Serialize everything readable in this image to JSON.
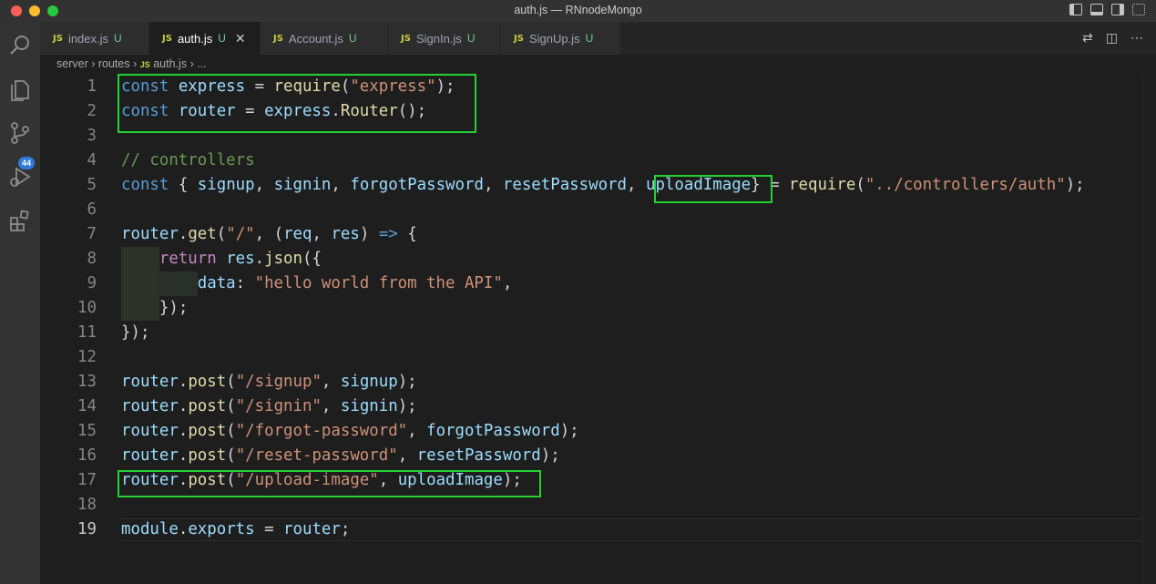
{
  "window": {
    "title": "auth.js — RNnodeMongo",
    "traffic_lights": {
      "close": "#ff5f57",
      "minimize": "#febc2e",
      "zoom": "#28c840"
    }
  },
  "activity_bar": {
    "items": [
      {
        "name": "explorer-icon"
      },
      {
        "name": "files-icon"
      },
      {
        "name": "source-control-icon",
        "badge": "44"
      },
      {
        "name": "run-debug-icon"
      },
      {
        "name": "extensions-icon"
      }
    ]
  },
  "tabs": [
    {
      "file_type": "JS",
      "label": "index.js",
      "status": "U"
    },
    {
      "file_type": "JS",
      "label": "auth.js",
      "status": "U",
      "active": true
    },
    {
      "file_type": "JS",
      "label": "Account.js",
      "status": "U"
    },
    {
      "file_type": "JS",
      "label": "SignIn.js",
      "status": "U"
    },
    {
      "file_type": "JS",
      "label": "SignUp.js",
      "status": "U"
    }
  ],
  "breadcrumb": {
    "items": [
      "server",
      "routes"
    ],
    "file_type": "JS",
    "file": "auth.js",
    "more": "..."
  },
  "editor": {
    "current_line": "19",
    "highlight_color": "#22d233",
    "lines": [
      {
        "n": "1",
        "tokens": [
          [
            "kw",
            "const "
          ],
          [
            "var",
            "express"
          ],
          [
            "pu",
            " = "
          ],
          [
            "fn",
            "require"
          ],
          [
            "pu",
            "("
          ],
          [
            "str",
            "\"express\""
          ],
          [
            "pu",
            ");"
          ]
        ]
      },
      {
        "n": "2",
        "tokens": [
          [
            "kw",
            "const "
          ],
          [
            "var",
            "router"
          ],
          [
            "pu",
            " = "
          ],
          [
            "var",
            "express"
          ],
          [
            "pu",
            "."
          ],
          [
            "fn",
            "Router"
          ],
          [
            "pu",
            "();"
          ]
        ]
      },
      {
        "n": "3",
        "tokens": []
      },
      {
        "n": "4",
        "tokens": [
          [
            "cm",
            "// controllers"
          ]
        ]
      },
      {
        "n": "5",
        "tokens": [
          [
            "kw",
            "const "
          ],
          [
            "pu",
            "{ "
          ],
          [
            "var",
            "signup"
          ],
          [
            "pu",
            ", "
          ],
          [
            "var",
            "signin"
          ],
          [
            "pu",
            ", "
          ],
          [
            "var",
            "forgotPassword"
          ],
          [
            "pu",
            ", "
          ],
          [
            "var",
            "resetPassword"
          ],
          [
            "pu",
            ", "
          ],
          [
            "var",
            "uploadImage"
          ],
          [
            "pu",
            "} = "
          ],
          [
            "fn",
            "require"
          ],
          [
            "pu",
            "("
          ],
          [
            "str",
            "\"../controllers/auth\""
          ],
          [
            "pu",
            ");"
          ]
        ]
      },
      {
        "n": "6",
        "tokens": []
      },
      {
        "n": "7",
        "tokens": [
          [
            "var",
            "router"
          ],
          [
            "pu",
            "."
          ],
          [
            "fn",
            "get"
          ],
          [
            "pu",
            "("
          ],
          [
            "str",
            "\"/\""
          ],
          [
            "pu",
            ", ("
          ],
          [
            "var",
            "req"
          ],
          [
            "pu",
            ", "
          ],
          [
            "var",
            "res"
          ],
          [
            "pu",
            ") "
          ],
          [
            "kw",
            "=>"
          ],
          [
            "pu",
            " {"
          ]
        ]
      },
      {
        "n": "8",
        "tokens": [
          [
            "pu",
            "    "
          ],
          [
            "ctl",
            "return "
          ],
          [
            "var",
            "res"
          ],
          [
            "pu",
            "."
          ],
          [
            "fn",
            "json"
          ],
          [
            "pu",
            "({"
          ]
        ]
      },
      {
        "n": "9",
        "tokens": [
          [
            "pu",
            "        "
          ],
          [
            "var",
            "data"
          ],
          [
            "pu",
            ": "
          ],
          [
            "str",
            "\"hello world from the API\""
          ],
          [
            "pu",
            ","
          ]
        ]
      },
      {
        "n": "10",
        "tokens": [
          [
            "pu",
            "    "
          ],
          [
            "pu",
            "});"
          ]
        ]
      },
      {
        "n": "11",
        "tokens": [
          [
            "pu",
            "});"
          ]
        ]
      },
      {
        "n": "12",
        "tokens": []
      },
      {
        "n": "13",
        "tokens": [
          [
            "var",
            "router"
          ],
          [
            "pu",
            "."
          ],
          [
            "fn",
            "post"
          ],
          [
            "pu",
            "("
          ],
          [
            "str",
            "\"/signup\""
          ],
          [
            "pu",
            ", "
          ],
          [
            "var",
            "signup"
          ],
          [
            "pu",
            ");"
          ]
        ]
      },
      {
        "n": "14",
        "tokens": [
          [
            "var",
            "router"
          ],
          [
            "pu",
            "."
          ],
          [
            "fn",
            "post"
          ],
          [
            "pu",
            "("
          ],
          [
            "str",
            "\"/signin\""
          ],
          [
            "pu",
            ", "
          ],
          [
            "var",
            "signin"
          ],
          [
            "pu",
            ");"
          ]
        ]
      },
      {
        "n": "15",
        "tokens": [
          [
            "var",
            "router"
          ],
          [
            "pu",
            "."
          ],
          [
            "fn",
            "post"
          ],
          [
            "pu",
            "("
          ],
          [
            "str",
            "\"/forgot-password\""
          ],
          [
            "pu",
            ", "
          ],
          [
            "var",
            "forgotPassword"
          ],
          [
            "pu",
            ");"
          ]
        ]
      },
      {
        "n": "16",
        "tokens": [
          [
            "var",
            "router"
          ],
          [
            "pu",
            "."
          ],
          [
            "fn",
            "post"
          ],
          [
            "pu",
            "("
          ],
          [
            "str",
            "\"/reset-password\""
          ],
          [
            "pu",
            ", "
          ],
          [
            "var",
            "resetPassword"
          ],
          [
            "pu",
            ");"
          ]
        ]
      },
      {
        "n": "17",
        "tokens": [
          [
            "var",
            "router"
          ],
          [
            "pu",
            "."
          ],
          [
            "fn",
            "post"
          ],
          [
            "pu",
            "("
          ],
          [
            "str",
            "\"/upload-image\""
          ],
          [
            "pu",
            ", "
          ],
          [
            "var",
            "uploadImage"
          ],
          [
            "pu",
            ");"
          ]
        ]
      },
      {
        "n": "18",
        "tokens": []
      },
      {
        "n": "19",
        "tokens": [
          [
            "var",
            "module"
          ],
          [
            "pu",
            "."
          ],
          [
            "var",
            "exports"
          ],
          [
            "pu",
            " = "
          ],
          [
            "var",
            "router"
          ],
          [
            "pu",
            ";"
          ]
        ]
      }
    ]
  }
}
